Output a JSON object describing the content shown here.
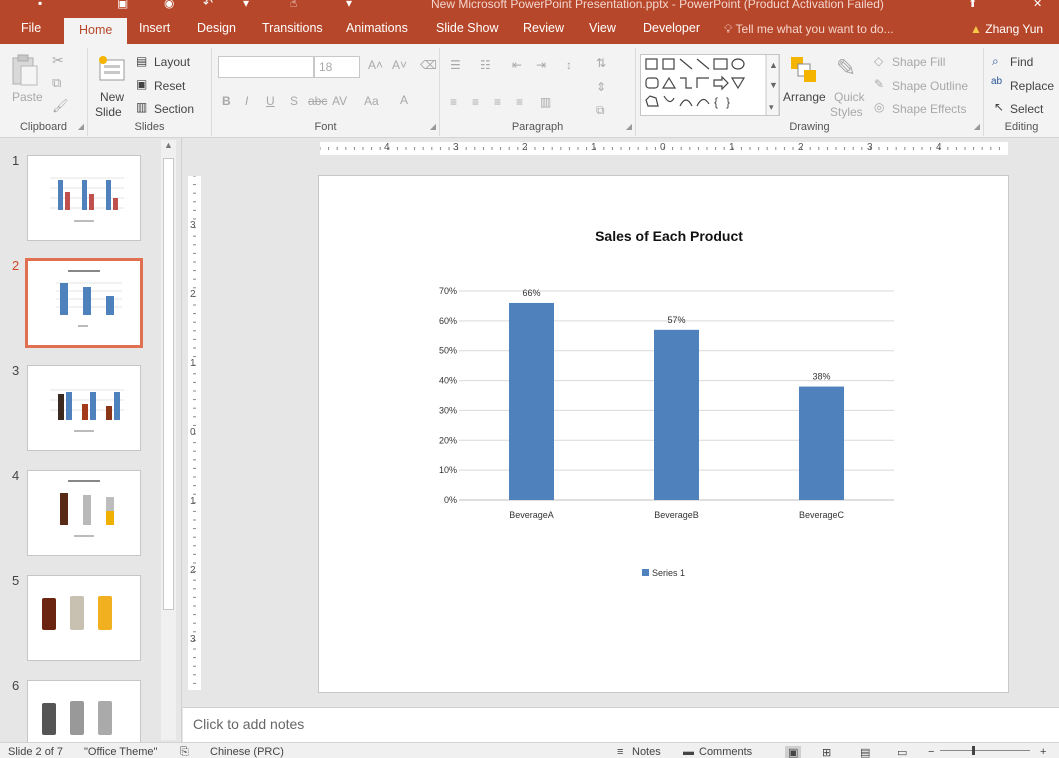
{
  "window": {
    "title": "New Microsoft PowerPoint Presentation.pptx - PowerPoint (Product Activation Failed)",
    "user": "Zhang Yun"
  },
  "tabs": [
    "File",
    "Home",
    "Insert",
    "Design",
    "Transitions",
    "Animations",
    "Slide Show",
    "Review",
    "View",
    "Developer"
  ],
  "tell_me": "Tell me what you want to do...",
  "ribbon": {
    "clipboard": {
      "label": "Clipboard",
      "paste": "Paste"
    },
    "slides": {
      "label": "Slides",
      "new_slide": "New",
      "new_slide2": "Slide",
      "layout": "Layout",
      "reset": "Reset",
      "section": "Section"
    },
    "font": {
      "label": "Font",
      "size": "18"
    },
    "paragraph": {
      "label": "Paragraph"
    },
    "drawing": {
      "label": "Drawing",
      "arrange": "Arrange",
      "quick_styles": "Quick",
      "quick_styles2": "Styles",
      "shape_fill": "Shape Fill",
      "shape_outline": "Shape Outline",
      "shape_effects": "Shape Effects"
    },
    "editing": {
      "label": "Editing",
      "find": "Find",
      "replace": "Replace",
      "select": "Select"
    }
  },
  "thumbnails": [
    {
      "num": "1"
    },
    {
      "num": "2"
    },
    {
      "num": "3"
    },
    {
      "num": "4"
    },
    {
      "num": "5"
    },
    {
      "num": "6"
    }
  ],
  "rulers": {
    "h": [
      "4",
      "3",
      "2",
      "1",
      "0",
      "1",
      "2",
      "3",
      "4"
    ],
    "v": [
      "3",
      "2",
      "1",
      "0",
      "1",
      "2",
      "3"
    ]
  },
  "chart_data": {
    "type": "bar",
    "title": "Sales of Each Product",
    "categories": [
      "BeverageA",
      "BeverageB",
      "BeverageC"
    ],
    "series": [
      {
        "name": "Series 1",
        "values": [
          66,
          57,
          38
        ],
        "labels": [
          "66%",
          "57%",
          "38%"
        ]
      }
    ],
    "yticks": [
      "0%",
      "10%",
      "20%",
      "30%",
      "40%",
      "50%",
      "60%",
      "70%"
    ],
    "ylim": [
      0,
      70
    ],
    "color": "#4f81bd",
    "legend_position": "bottom",
    "grid": true
  },
  "notes_placeholder": "Click to add notes",
  "status": {
    "slide": "Slide 2 of 7",
    "theme": "\"Office Theme\"",
    "language": "Chinese (PRC)",
    "notes": "Notes",
    "comments": "Comments"
  }
}
